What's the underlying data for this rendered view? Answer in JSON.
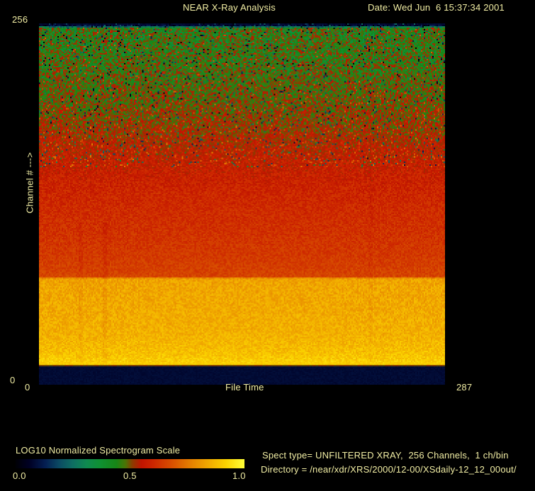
{
  "window": {
    "background": "#000000",
    "text_color": "#f1eda4"
  },
  "header": {
    "title": "NEAR X-Ray Analysis",
    "date_label": "Date: Wed Jun  6 15:37:34 2001"
  },
  "plot": {
    "y_axis": {
      "label": "Channel # --->",
      "max": "256",
      "min": "0"
    },
    "x_axis": {
      "label": "File Time",
      "min": "0",
      "max": "287"
    }
  },
  "colorbar": {
    "title": "LOG10 Normalized Spectrogram Scale",
    "ticks": [
      "0.0",
      "0.5",
      "1.0"
    ]
  },
  "info": {
    "spect_type": "Spect type= UNFILTERED XRAY,  256 Channels,  1 ch/bin",
    "directory": "Directory = /near/xdr/XRS/2000/12-00/XSdaily-12_12_00out/"
  },
  "chart_data": {
    "type": "heatmap",
    "title": "NEAR X-Ray Analysis",
    "xlabel": "File Time",
    "ylabel": "Channel #",
    "x_range": [
      0,
      287
    ],
    "y_range": [
      0,
      256
    ],
    "bins": {
      "x": 287,
      "y": 256
    },
    "scale": {
      "label": "LOG10 Normalized Spectrogram Scale",
      "range": [
        0.0,
        1.0
      ],
      "tick_values": [
        0.0,
        0.5,
        1.0
      ]
    },
    "legend_position": "bottom-left",
    "grid": false,
    "colormap_stops": [
      [
        0.0,
        "#000005"
      ],
      [
        0.06,
        "#000024"
      ],
      [
        0.13,
        "#041e52"
      ],
      [
        0.19,
        "#0b4a63"
      ],
      [
        0.25,
        "#0e6e62"
      ],
      [
        0.31,
        "#0f8a50"
      ],
      [
        0.37,
        "#0f9132"
      ],
      [
        0.44,
        "#178616"
      ],
      [
        0.48,
        "#4a7405"
      ],
      [
        0.51,
        "#8c3c00"
      ],
      [
        0.55,
        "#c01400"
      ],
      [
        0.6,
        "#cd2600"
      ],
      [
        0.68,
        "#d84e00"
      ],
      [
        0.76,
        "#e57d00"
      ],
      [
        0.84,
        "#f0a800"
      ],
      [
        0.92,
        "#fbd300"
      ],
      [
        1.0,
        "#ffff38"
      ]
    ],
    "value_profile": [
      [
        0.0,
        0.08
      ],
      [
        0.006,
        0.1
      ],
      [
        0.01,
        0.44
      ],
      [
        0.06,
        0.445
      ],
      [
        0.15,
        0.465
      ],
      [
        0.25,
        0.505
      ],
      [
        0.35,
        0.555
      ],
      [
        0.45,
        0.59
      ],
      [
        0.55,
        0.615
      ],
      [
        0.65,
        0.64
      ],
      [
        0.703,
        0.66
      ],
      [
        0.707,
        0.83
      ],
      [
        0.78,
        0.84
      ],
      [
        0.86,
        0.855
      ],
      [
        0.91,
        0.88
      ],
      [
        0.938,
        0.91
      ],
      [
        0.9451,
        0.91
      ],
      [
        0.949,
        0.505
      ],
      [
        0.9529,
        0.085
      ],
      [
        1.0,
        0.085
      ]
    ],
    "noise_profile": [
      [
        0.0,
        0.015
      ],
      [
        0.01,
        0.105
      ],
      [
        0.2,
        0.085
      ],
      [
        0.35,
        0.055
      ],
      [
        0.5,
        0.04
      ],
      [
        0.7,
        0.035
      ],
      [
        0.71,
        0.045
      ],
      [
        0.935,
        0.04
      ],
      [
        0.95,
        0.01
      ],
      [
        1.0,
        0.01
      ]
    ],
    "speckles": {
      "t_max": 0.4,
      "dark_prob": 0.05,
      "dark_depth": [
        0.15,
        0.45
      ],
      "bright_prob": 0.06,
      "bright_boost": [
        0.08,
        0.18
      ]
    },
    "stripes": [
      {
        "x_frac": 0.101,
        "t_range": [
          0.55,
          0.94
        ],
        "delta": -0.02
      },
      {
        "x_frac": 0.162,
        "t_range": [
          0.55,
          0.94
        ],
        "delta": -0.025
      },
      {
        "x_frac": 0.815,
        "t_range": [
          0.35,
          0.94
        ],
        "delta": -0.015
      }
    ],
    "noise_seed": 42
  }
}
